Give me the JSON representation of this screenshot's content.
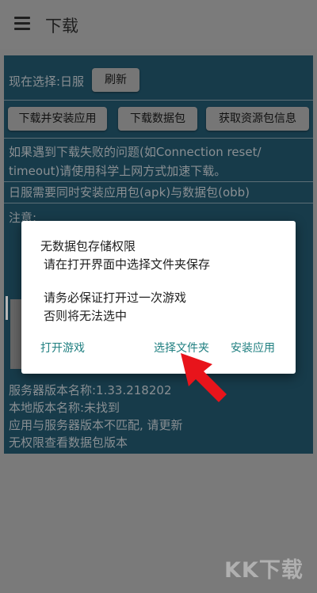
{
  "appbar": {
    "title": "下载",
    "menu_icon": "menu-icon"
  },
  "main": {
    "selection_label": "现在选择:日服",
    "refresh_label": "刷新",
    "actions": {
      "install_app": "下载并安装应用",
      "download_data": "下载数据包",
      "resource_info": "获取资源包信息"
    },
    "hint_line1": "如果遇到下载失败的问题(如Connection reset/",
    "hint_line2": "timeout)请使用科学上网方式加速下载。",
    "jp_note": "日服需要同时安装应用包(apk)与数据包(obb)",
    "notice_label": "注意:",
    "server_version": "服务器版本名称:1.33.218202",
    "local_version": "本地版本名称:未找到",
    "mismatch": "应用与服务器版本不匹配, 请更新",
    "no_permission": "无权限查看数据包版本"
  },
  "dialog": {
    "line1": "无数据包存储权限",
    "line2": "请在打开界面中选择文件夹保存",
    "line3": "请务必保证打开过一次游戏",
    "line4": "否则将无法选中",
    "btn_open_game": "打开游戏",
    "btn_choose_folder": "选择文件夹",
    "btn_install_app": "安装应用"
  },
  "watermark": "KK下载",
  "colors": {
    "panel": "#173b4a",
    "dialog_button": "#1f7f80",
    "arrow": "#e8141b"
  }
}
